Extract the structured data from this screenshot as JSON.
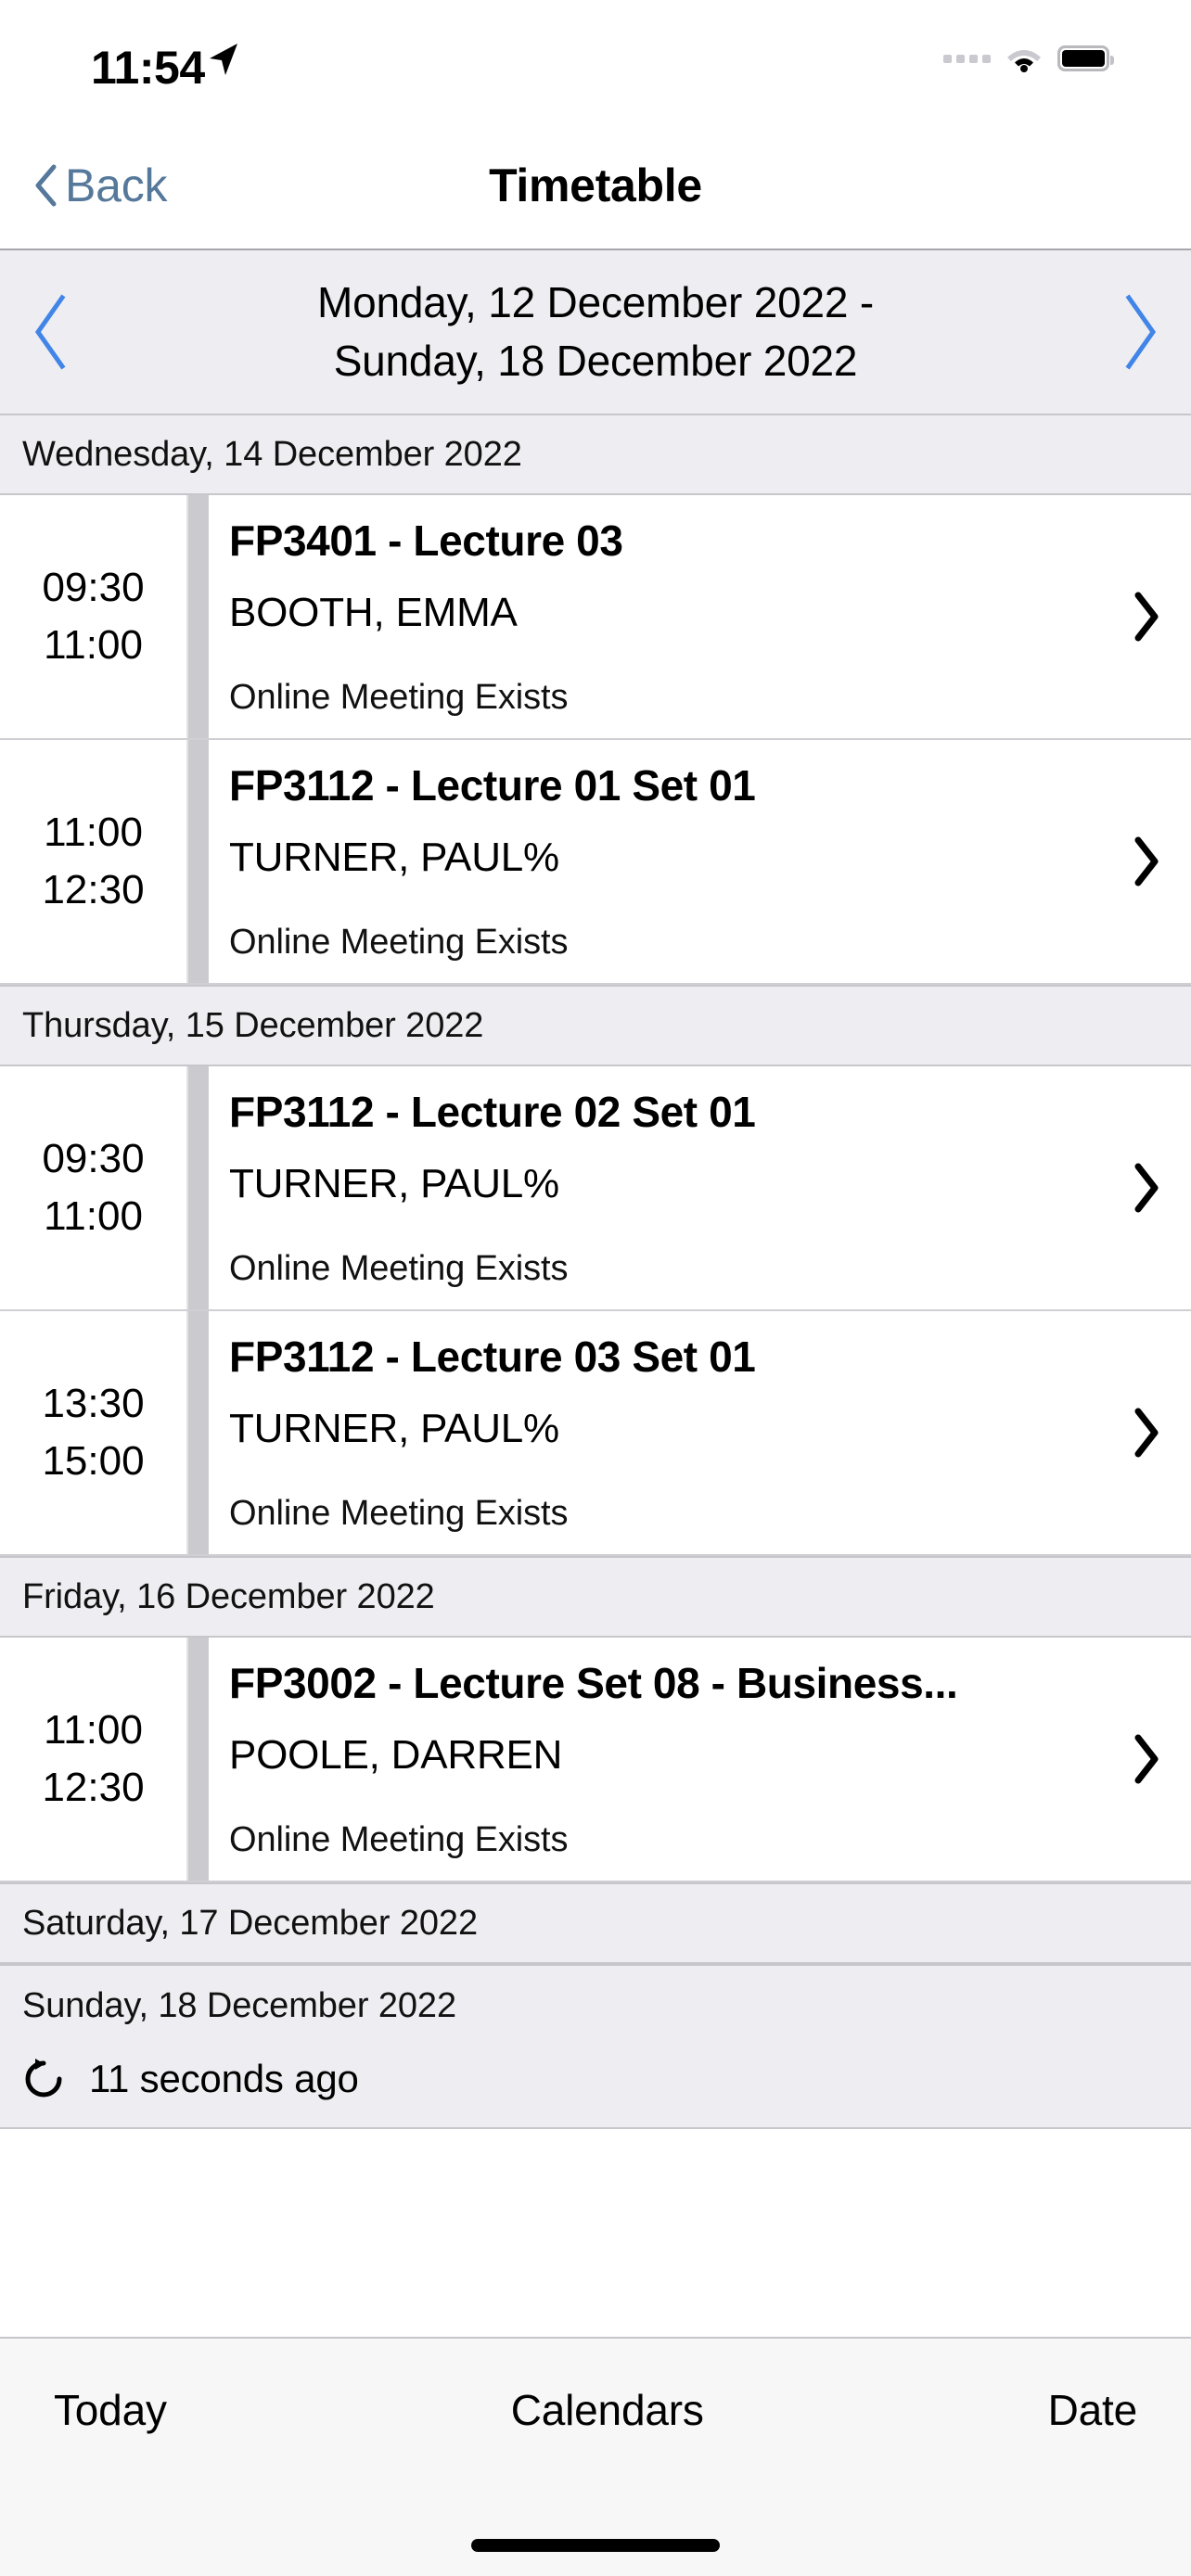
{
  "status_bar": {
    "time": "11:54",
    "location_icon": "location-arrow-icon",
    "cellular_icon": "cellular-dots-icon",
    "wifi_icon": "wifi-icon",
    "battery_icon": "battery-full-icon"
  },
  "nav": {
    "back_label": "Back",
    "back_icon": "chevron-left-icon",
    "title": "Timetable",
    "back_color": "#56799b"
  },
  "week_picker": {
    "prev_icon": "chevron-left-icon",
    "next_icon": "chevron-right-icon",
    "range_line1": "Monday, 12 December 2022 -",
    "range_line2": "Sunday, 18 December 2022",
    "accent_color": "#4285e8",
    "background_color": "#eeeef2"
  },
  "days": [
    {
      "header": "Wednesday, 14 December 2022",
      "events": [
        {
          "start": "09:30",
          "end": "11:00",
          "title": "FP3401 - Lecture 03",
          "lecturer": "BOOTH, EMMA",
          "meta": "Online Meeting Exists",
          "disclosure_icon": "chevron-right-icon"
        },
        {
          "start": "11:00",
          "end": "12:30",
          "title": "FP3112 - Lecture 01 Set 01",
          "lecturer": "TURNER, PAUL%",
          "meta": "Online Meeting Exists",
          "disclosure_icon": "chevron-right-icon"
        }
      ]
    },
    {
      "header": "Thursday, 15 December 2022",
      "events": [
        {
          "start": "09:30",
          "end": "11:00",
          "title": "FP3112 - Lecture 02 Set 01",
          "lecturer": "TURNER, PAUL%",
          "meta": "Online Meeting Exists",
          "disclosure_icon": "chevron-right-icon"
        },
        {
          "start": "13:30",
          "end": "15:00",
          "title": "FP3112 - Lecture 03 Set 01",
          "lecturer": "TURNER, PAUL%",
          "meta": "Online Meeting Exists",
          "disclosure_icon": "chevron-right-icon"
        }
      ]
    },
    {
      "header": "Friday, 16 December 2022",
      "events": [
        {
          "start": "11:00",
          "end": "12:30",
          "title": "FP3002 - Lecture Set 08 - Business...",
          "lecturer": "POOLE, DARREN",
          "meta": "Online Meeting Exists",
          "disclosure_icon": "chevron-right-icon"
        }
      ]
    },
    {
      "header": "Saturday, 17 December 2022",
      "events": []
    },
    {
      "header": "Sunday, 18 December 2022",
      "events": []
    }
  ],
  "refresh": {
    "icon": "refresh-icon",
    "label": "11 seconds ago"
  },
  "toolbar": {
    "today_label": "Today",
    "calendars_label": "Calendars",
    "date_label": "Date"
  }
}
